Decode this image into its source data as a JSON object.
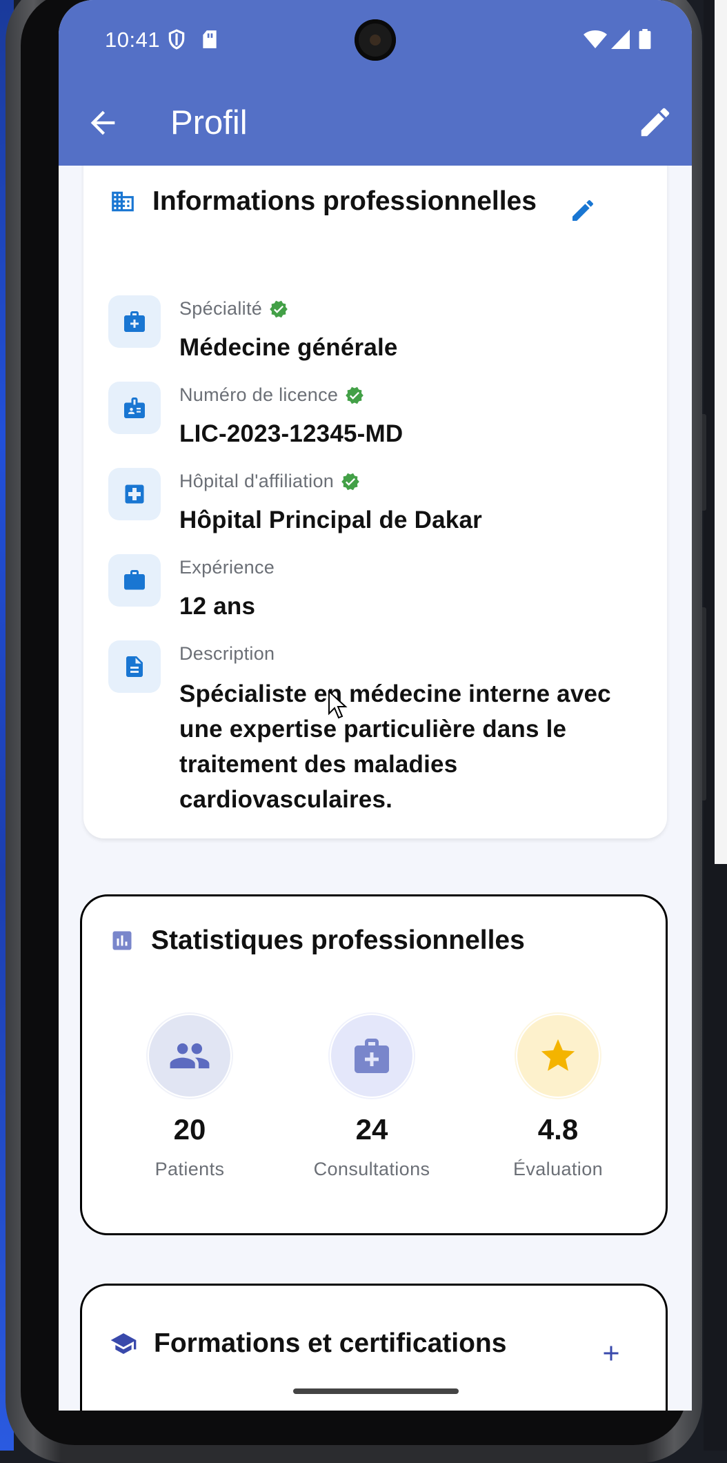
{
  "status_bar": {
    "time": "10:41"
  },
  "app_bar": {
    "title": "Profil"
  },
  "pro_info": {
    "title": "Informations professionnelles",
    "rows": [
      {
        "label": "Spécialité",
        "value": "Médecine générale",
        "verified": true,
        "icon": "medical-bag-icon"
      },
      {
        "label": "Numéro de licence",
        "value": "LIC-2023-12345-MD",
        "verified": true,
        "icon": "badge-icon"
      },
      {
        "label": "Hôpital d'affiliation",
        "value": "Hôpital Principal de Dakar",
        "verified": true,
        "icon": "hospital-cross-icon"
      },
      {
        "label": "Expérience",
        "value": "12 ans",
        "verified": false,
        "icon": "briefcase-icon"
      },
      {
        "label": "Description",
        "value": "Spécialiste en médecine interne avec une expertise particulière dans le traitement des maladies cardiovasculaires.",
        "verified": false,
        "icon": "document-icon"
      }
    ]
  },
  "stats": {
    "title": "Statistiques professionnelles",
    "items": [
      {
        "value": "20",
        "label": "Patients",
        "icon": "people-icon",
        "color": "#5c6bc0"
      },
      {
        "value": "24",
        "label": "Consultations",
        "icon": "medical-bag-icon",
        "color": "#7986cb"
      },
      {
        "value": "4.8",
        "label": "Évaluation",
        "icon": "star-icon",
        "color": "#f4b400"
      }
    ]
  },
  "training": {
    "title": "Formations et certifications"
  },
  "colors": {
    "app_bar": "#5470c6",
    "accent_blue": "#1976d2",
    "verified_green": "#43a047"
  }
}
